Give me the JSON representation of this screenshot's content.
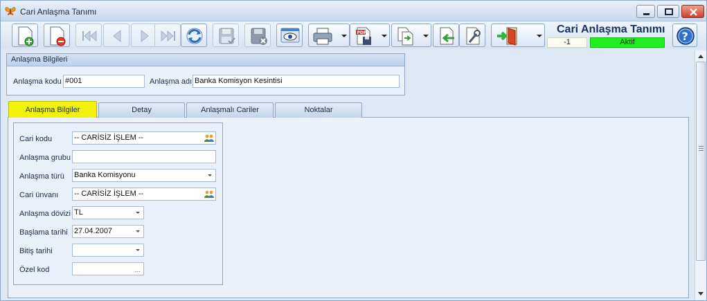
{
  "window": {
    "title": "Cari Anlaşma Tanımı",
    "icon": "butterfly-icon"
  },
  "toolbar": {
    "buttons": [
      {
        "name": "new-record-icon",
        "enabled": true
      },
      {
        "name": "delete-record-icon",
        "enabled": true
      },
      {
        "name": "first-record-icon",
        "enabled": false
      },
      {
        "name": "prev-record-icon",
        "enabled": false
      },
      {
        "name": "next-record-icon",
        "enabled": false
      },
      {
        "name": "last-record-icon",
        "enabled": false
      },
      {
        "name": "refresh-icon",
        "enabled": true
      },
      {
        "name": "save-icon",
        "enabled": false
      },
      {
        "name": "cancel-save-icon",
        "enabled": false
      },
      {
        "name": "preview-icon",
        "enabled": true
      },
      {
        "name": "print-icon",
        "enabled": true
      },
      {
        "name": "pdf-export-icon",
        "enabled": true
      },
      {
        "name": "copy-document-icon",
        "enabled": true
      },
      {
        "name": "import-document-icon",
        "enabled": true
      },
      {
        "name": "settings-document-icon",
        "enabled": true
      },
      {
        "name": "exit-door-icon",
        "enabled": true
      }
    ]
  },
  "header": {
    "title": "Cari Anlaşma Tanımı",
    "record_id": "-1",
    "status": "Aktif",
    "status_color": "#1fef1f"
  },
  "info_group": {
    "title": "Anlaşma Bilgileri",
    "code_label": "Anlaşma kodu",
    "code_value": "#001",
    "name_label": "Anlaşma adı",
    "name_value": "Banka Komisyon Kesintisi"
  },
  "tabs": [
    {
      "label": "Anlaşma Bilgiler",
      "active": true
    },
    {
      "label": "Detay",
      "active": false
    },
    {
      "label": "Anlaşmalı Cariler",
      "active": false
    },
    {
      "label": "Noktalar",
      "active": false
    }
  ],
  "form": {
    "cari_kodu": {
      "label": "Cari kodu",
      "value": "-- CARİSİZ İŞLEM --"
    },
    "anlasma_grubu": {
      "label": "Anlaşma grubu",
      "value": ""
    },
    "anlasma_turu": {
      "label": "Anlaşma türü",
      "value": "Banka Komisyonu"
    },
    "cari_unvani": {
      "label": "Cari ünvanı",
      "value": "-- CARİSİZ İŞLEM --"
    },
    "anlasma_dovizi": {
      "label": "Anlaşma dövizi",
      "value": "TL"
    },
    "baslama_tarihi": {
      "label": "Başlama tarihi",
      "value": "27.04.2007"
    },
    "bitis_tarihi": {
      "label": "Bitiş tarihi",
      "value": ""
    },
    "ozel_kod": {
      "label": "Özel kod",
      "value": "",
      "button": "..."
    }
  },
  "colors": {
    "accent": "#14305c",
    "active_tab": "#f2f20a"
  }
}
